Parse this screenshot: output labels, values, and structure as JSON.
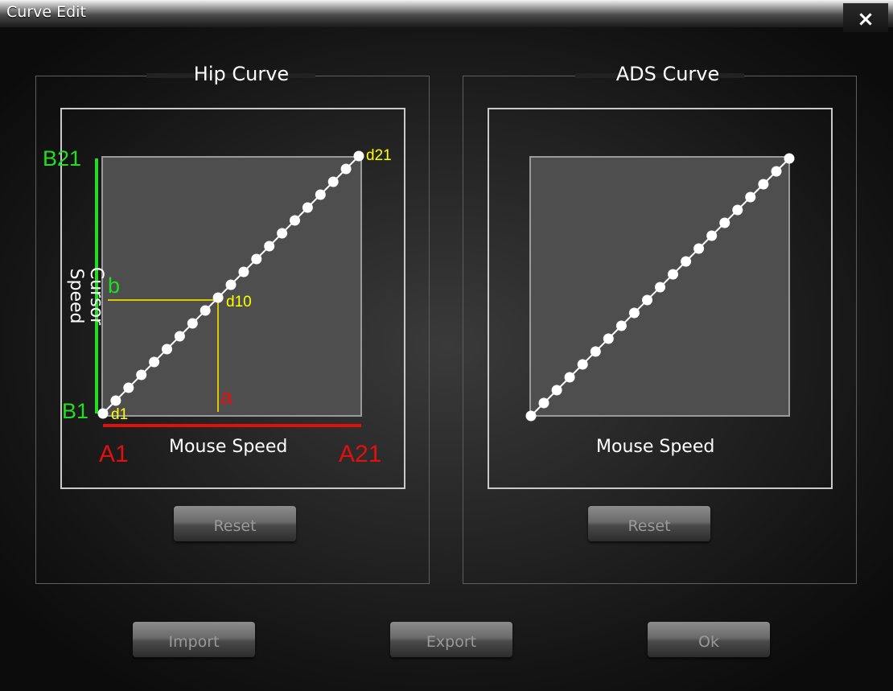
{
  "window": {
    "title": "Curve Edit",
    "close_label": "×"
  },
  "hip_curve": {
    "title": "Hip Curve",
    "x_axis_label": "Mouse Speed",
    "y_axis_label": "Cursor Speed",
    "reset_label": "Reset",
    "annotations": {
      "A1": "A1",
      "A21": "A21",
      "B1": "B1",
      "B21": "B21",
      "a": "a",
      "b": "b",
      "d1": "d1",
      "d10": "d10",
      "d21": "d21"
    },
    "colors": {
      "x_axis": "#e01010",
      "y_axis": "#22dd22",
      "guide": "#d8c800",
      "point_label": "#ffff00",
      "point": "#ffffff"
    }
  },
  "ads_curve": {
    "title": "ADS Curve",
    "x_axis_label": "Mouse Speed",
    "reset_label": "Reset"
  },
  "footer": {
    "import_label": "Import",
    "export_label": "Export",
    "ok_label": "Ok"
  },
  "chart_data": [
    {
      "type": "line",
      "name": "Hip Curve",
      "points": 21,
      "x": [
        1,
        2,
        3,
        4,
        5,
        6,
        7,
        8,
        9,
        10,
        11,
        12,
        13,
        14,
        15,
        16,
        17,
        18,
        19,
        20,
        21
      ],
      "y": [
        1,
        2,
        3,
        4,
        5,
        6,
        7,
        8,
        9,
        10,
        11,
        12,
        13,
        14,
        15,
        16,
        17,
        18,
        19,
        20,
        21
      ]
    },
    {
      "type": "line",
      "name": "ADS Curve",
      "points": 21,
      "x": [
        1,
        2,
        3,
        4,
        5,
        6,
        7,
        8,
        9,
        10,
        11,
        12,
        13,
        14,
        15,
        16,
        17,
        18,
        19,
        20,
        21
      ],
      "y": [
        1,
        2,
        3,
        4,
        5,
        6,
        7,
        8,
        9,
        10,
        11,
        12,
        13,
        14,
        15,
        16,
        17,
        18,
        19,
        20,
        21
      ]
    }
  ]
}
